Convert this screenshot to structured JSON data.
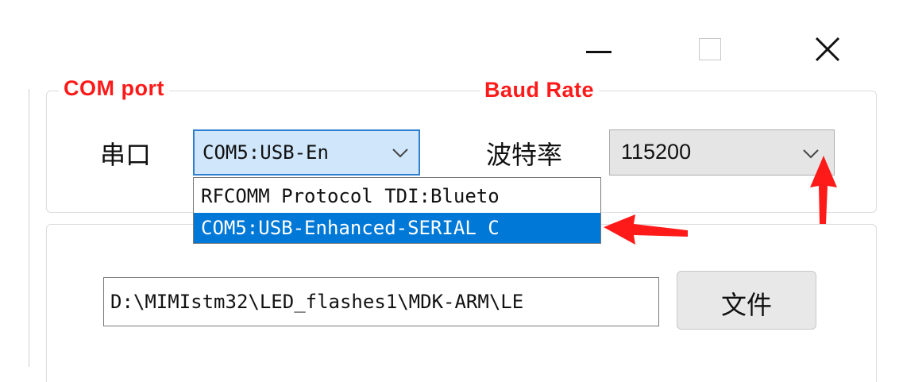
{
  "window_controls": {
    "minimize_icon": "minimize-icon",
    "maximize_icon": "maximize-icon",
    "close_icon": "close-icon"
  },
  "annotations": {
    "com_port_label": "COM  port",
    "baud_rate_label": "Baud  Rate",
    "color": "#ff1a1a"
  },
  "serial_group": {
    "port_label": "串口",
    "port_combo_value": "COM5:USB-En",
    "baud_label": "波特率",
    "baud_combo_value": "115200",
    "port_options": [
      "RFCOMM Protocol TDI:Blueto",
      "COM5:USB-Enhanced-SERIAL C"
    ],
    "selected_option_index": 1,
    "selection_color": "#0078d7"
  },
  "file_group": {
    "path_value": "D:\\MIMIstm32\\LED_flashes1\\MDK-ARM\\LE",
    "file_button_label": "文件"
  }
}
